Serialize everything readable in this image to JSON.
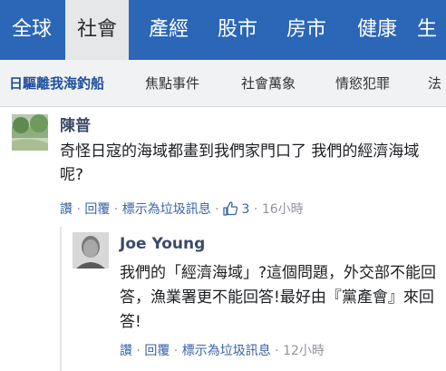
{
  "top_nav": {
    "tabs": [
      "全球",
      "社會",
      "產經",
      "股市",
      "房市",
      "健康",
      "生"
    ],
    "active_index": 1
  },
  "sub_nav": {
    "items": [
      "日驅離我海釣船",
      "焦點事件",
      "社會萬象",
      "情慾犯罪",
      "法"
    ],
    "active_index": 0
  },
  "comment": {
    "author": "陳普",
    "text": "奇怪日寇的海域都畫到我們家門口了 我們的經濟海域呢?",
    "actions": {
      "like": "讚",
      "reply": "回覆",
      "report": "標示為垃圾訊息",
      "like_count": "3",
      "time": "16小時"
    }
  },
  "reply": {
    "author": "Joe Young",
    "text": "我們的「經濟海域」?這個問題，外交部不能回答，漁業署更不能回答!最好由『黨產會』來回答!",
    "actions": {
      "like": "讚",
      "reply": "回覆",
      "report": "標示為垃圾訊息",
      "time": "12小時"
    }
  },
  "colors": {
    "nav_bg": "#2b66b7",
    "link": "#3a63a8",
    "author": "#3b4a68"
  }
}
